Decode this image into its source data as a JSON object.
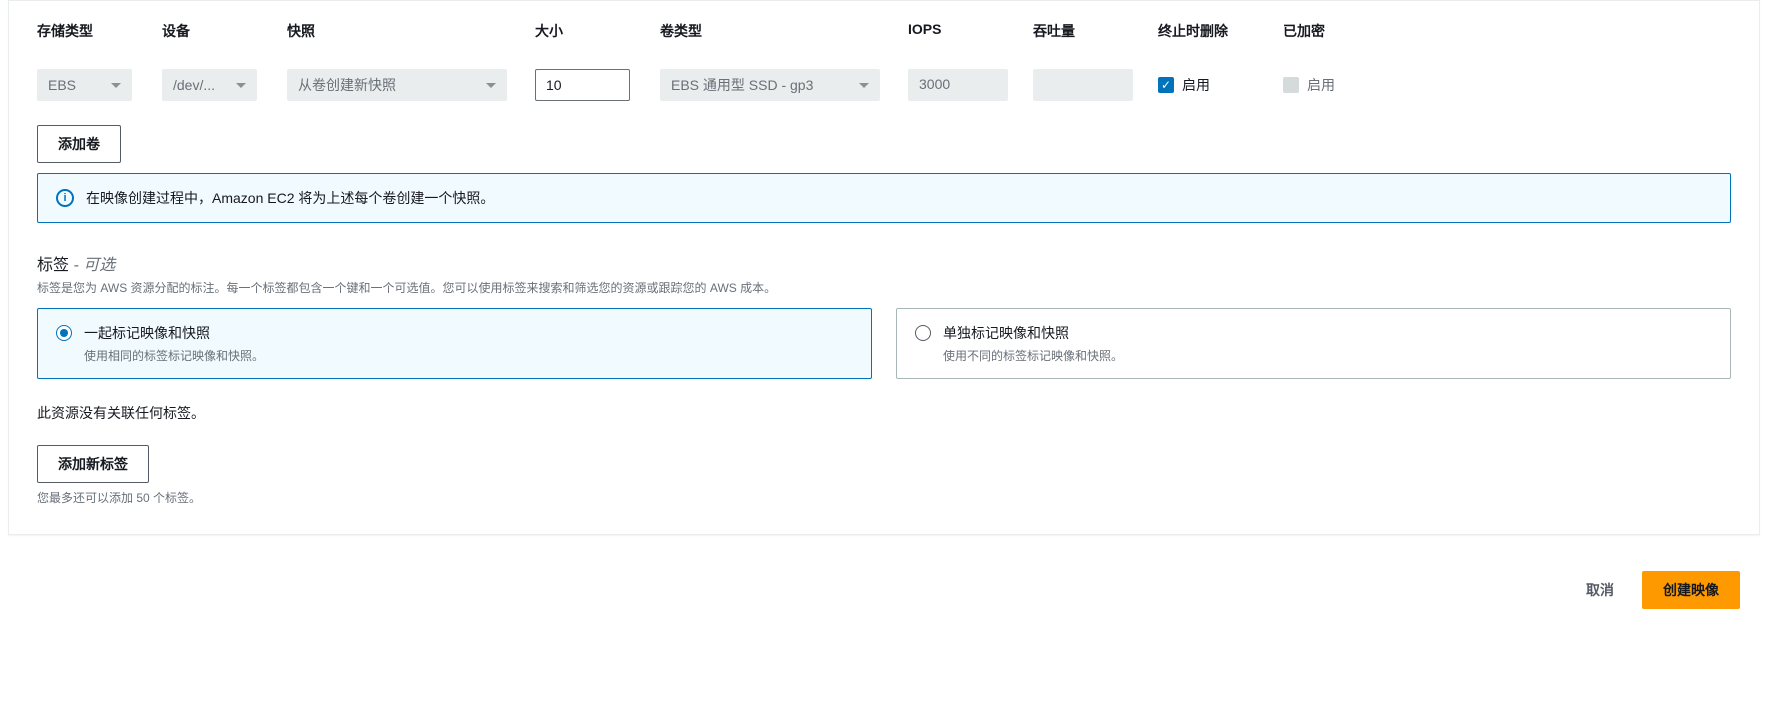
{
  "columns": {
    "storage_type": "存储类型",
    "device": "设备",
    "snapshot": "快照",
    "size": "大小",
    "volume_type": "卷类型",
    "iops": "IOPS",
    "throughput": "吞吐量",
    "delete_on_termination": "终止时删除",
    "encrypted": "已加密"
  },
  "row": {
    "storage_type": "EBS",
    "device": "/dev/...",
    "snapshot": "从卷创建新快照",
    "size": "10",
    "volume_type": "EBS 通用型 SSD - gp3",
    "iops": "3000",
    "throughput": "",
    "delete_on_termination_label": "启用",
    "encrypted_label": "启用"
  },
  "add_volume_button": "添加卷",
  "info_message": "在映像创建过程中，Amazon EC2 将为上述每个卷创建一个快照。",
  "tags_section": {
    "title": "标签",
    "optional_suffix": "- 可选",
    "description": "标签是您为 AWS 资源分配的标注。每一个标签都包含一个键和一个可选值。您可以使用标签来搜索和筛选您的资源或跟踪您的 AWS 成本。",
    "option_together": {
      "title": "一起标记映像和快照",
      "desc": "使用相同的标签标记映像和快照。"
    },
    "option_separate": {
      "title": "单独标记映像和快照",
      "desc": "使用不同的标签标记映像和快照。"
    },
    "no_tags_message": "此资源没有关联任何标签。",
    "add_tag_button": "添加新标签",
    "limit_message": "您最多还可以添加 50 个标签。"
  },
  "footer": {
    "cancel": "取消",
    "create": "创建映像"
  }
}
